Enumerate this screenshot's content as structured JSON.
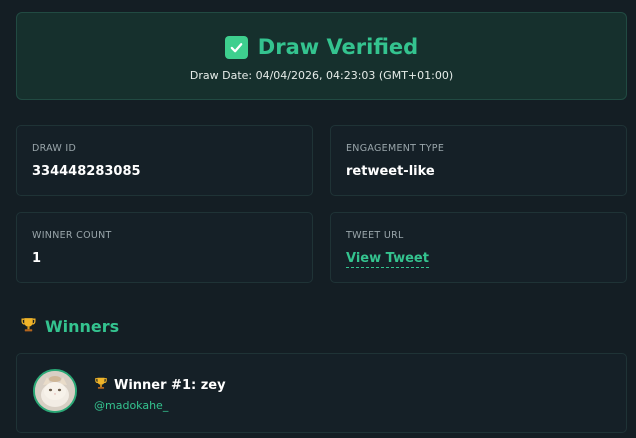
{
  "banner": {
    "title": "Draw Verified",
    "date": "Draw Date: 04/04/2026, 04:23:03 (GMT+01:00)",
    "icon": "check-icon"
  },
  "cards": {
    "draw_id": {
      "label": "DRAW ID",
      "value": "334448283085"
    },
    "engagement_type": {
      "label": "ENGAGEMENT TYPE",
      "value": "retweet-like"
    },
    "winner_count": {
      "label": "WINNER COUNT",
      "value": "1"
    },
    "tweet_url": {
      "label": "TWEET URL",
      "link_text": "View Tweet"
    }
  },
  "winners": {
    "heading": "Winners",
    "heading_icon": "trophy-icon",
    "items": [
      {
        "title": "Winner #1: zey",
        "handle": "@madokahe_",
        "icon": "trophy-icon"
      }
    ]
  },
  "colors": {
    "accent": "#34c38f",
    "background": "#141e24",
    "card": "#152027",
    "banner": "#16302d"
  }
}
